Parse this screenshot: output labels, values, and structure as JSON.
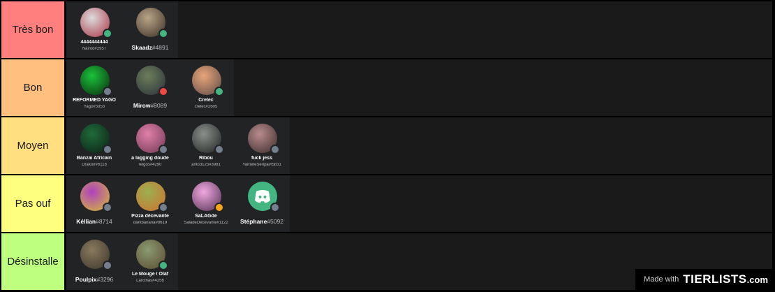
{
  "tiers": [
    {
      "label": "Très bon",
      "color": "#ff7f7f",
      "items": [
        {
          "name": "4444444444",
          "tag": "Nairod#2957",
          "status": "online",
          "avatar_colors": [
            "#dcdcdc",
            "#a34"
          ]
        },
        {
          "name": "Skaadz",
          "tag": "#4891",
          "status": "online",
          "inline_tag": true,
          "avatar_colors": [
            "#b9a488",
            "#3a2f25"
          ]
        }
      ]
    },
    {
      "label": "Bon",
      "color": "#ffbf7f",
      "items": [
        {
          "name": "REFORMED YAGO",
          "tag": "Yago#5953",
          "status": "offline",
          "avatar_colors": [
            "#1bc23b",
            "#0a2a0d"
          ]
        },
        {
          "name": "Mirow",
          "tag": "#8089",
          "status": "dnd",
          "inline_tag": true,
          "avatar_colors": [
            "#6b7e5a",
            "#2b2f3a"
          ]
        },
        {
          "name": "Crelec",
          "tag": "crelec#2605",
          "status": "online",
          "avatar_colors": [
            "#e8a478",
            "#5b4a48"
          ]
        }
      ]
    },
    {
      "label": "Moyen",
      "color": "#ffdf7f",
      "items": [
        {
          "name": "Banzai Africain",
          "tag": "Drakoir#6118",
          "status": "offline",
          "avatar_colors": [
            "#1f6b3b",
            "#0c1f14"
          ]
        },
        {
          "name": "a lagging doude",
          "tag": "reigos#4290",
          "status": "offline",
          "avatar_colors": [
            "#e07fa8",
            "#703852"
          ]
        },
        {
          "name": "Ribou",
          "tag": "anto3125#3981",
          "status": "offline",
          "avatar_colors": [
            "#8a8f8c",
            "#1d2220"
          ]
        },
        {
          "name": "fuck jess",
          "tag": "YameteSenpai#5831",
          "status": "offline",
          "avatar_colors": [
            "#b88c8c",
            "#3a2a2a"
          ]
        }
      ]
    },
    {
      "label": "Pas ouf",
      "color": "#ffff7f",
      "items": [
        {
          "name": "Kéllian",
          "tag": "#8714",
          "status": "offline",
          "inline_tag": true,
          "avatar_colors": [
            "#b040c0",
            "#d4c030"
          ]
        },
        {
          "name": "Pizza décevante",
          "tag": "darkbanana#8619",
          "status": "offline",
          "avatar_colors": [
            "#9ab050",
            "#d07030"
          ]
        },
        {
          "name": "SaLAGde",
          "tag": "SaladeDécevante#1122",
          "status": "idle",
          "avatar_colors": [
            "#f0a8e0",
            "#503050"
          ]
        },
        {
          "name": "Stéphane",
          "tag": "#5092",
          "status": "offline",
          "inline_tag": true,
          "avatar_colors": [
            "#43b581",
            "#43b581"
          ],
          "discord_logo": true
        }
      ]
    },
    {
      "label": "Désinstalle",
      "color": "#bfff7f",
      "items": [
        {
          "name": "Poulpix",
          "tag": "#3296",
          "status": "offline",
          "inline_tag": true,
          "avatar_colors": [
            "#8a7a60",
            "#3b3528"
          ]
        },
        {
          "name": "Le Mouge / Olaf",
          "tag": "Larcthas#4256",
          "status": "online",
          "avatar_colors": [
            "#8a9a70",
            "#5a4a30"
          ]
        }
      ]
    }
  ],
  "watermark": {
    "made_with": "Made with",
    "logo": "TIERLISTS",
    "suffix": ".com"
  }
}
